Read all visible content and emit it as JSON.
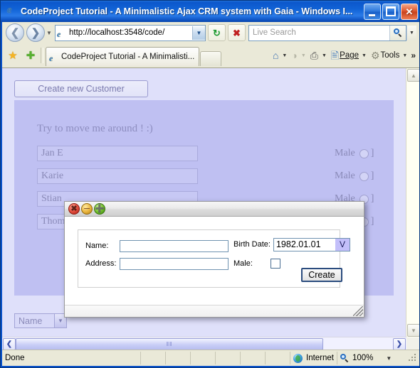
{
  "window": {
    "title": "CodeProject Tutorial - A Minimalistic Ajax CRM system with Gaia - Windows I...",
    "minimize_label": "Minimize",
    "maximize_label": "Maximize",
    "close_label": "Close"
  },
  "navigation": {
    "back_label": "Back",
    "forward_label": "Forward",
    "recent_pages_label": "Recent Pages",
    "url": "http://localhost:3548/code/",
    "refresh_label": "Refresh",
    "stop_label": "Stop"
  },
  "search": {
    "placeholder": "Live Search",
    "go_label": "Search",
    "dropdown_label": "Search Options"
  },
  "tabbar": {
    "favorites_label": "Favorites Center",
    "add_favorite_label": "Add to Favorites",
    "tabs": [
      {
        "label": "CodeProject Tutorial - A Minimalisti..."
      }
    ],
    "new_tab_label": "New Tab"
  },
  "commandbar": {
    "home_label": "Home",
    "feeds_label": "Feeds",
    "print_label": "Print",
    "page_label": "Page",
    "tools_label": "Tools",
    "overflow_label": "»"
  },
  "page": {
    "create_new_customer_button": "Create new Customer",
    "heading": "Try to move me around ! :)",
    "customers": [
      {
        "name": "Jan E",
        "gender": "Male"
      },
      {
        "name": "Karie",
        "gender": "Male"
      },
      {
        "name": "Stian",
        "gender": "Male"
      },
      {
        "name": "Thom",
        "gender": "Male"
      }
    ],
    "sort_select_value": "Name"
  },
  "dialog": {
    "close_label": "Close",
    "minimize_label": "Minimize",
    "maximize_label": "Maximize",
    "name_label": "Name:",
    "name_value": "",
    "address_label": "Address:",
    "address_value": "",
    "birth_date_label": "Birth Date:",
    "birth_date_value": "1982.01.01",
    "birth_date_dropdown": "V",
    "male_label": "Male:",
    "male_checked": false,
    "create_button": "Create",
    "resize_label": "Resize"
  },
  "scrollbars": {
    "v_up_label": "Scroll Up",
    "v_down_label": "Scroll Down",
    "h_left_label": "Scroll Left",
    "h_right_label": "Scroll Right",
    "h_thumb_label": "‖‖"
  },
  "statusbar": {
    "status": "Done",
    "zone": "Internet",
    "zoom": "100%",
    "zoom_dropdown": "▾"
  },
  "colors": {
    "title_blue": "#0c57cc",
    "chrome_tan": "#eae9d8",
    "page_lavender": "#dfe0fa",
    "panel_lavender": "#bfc0f2",
    "accent_purple": "#c3bffa"
  }
}
